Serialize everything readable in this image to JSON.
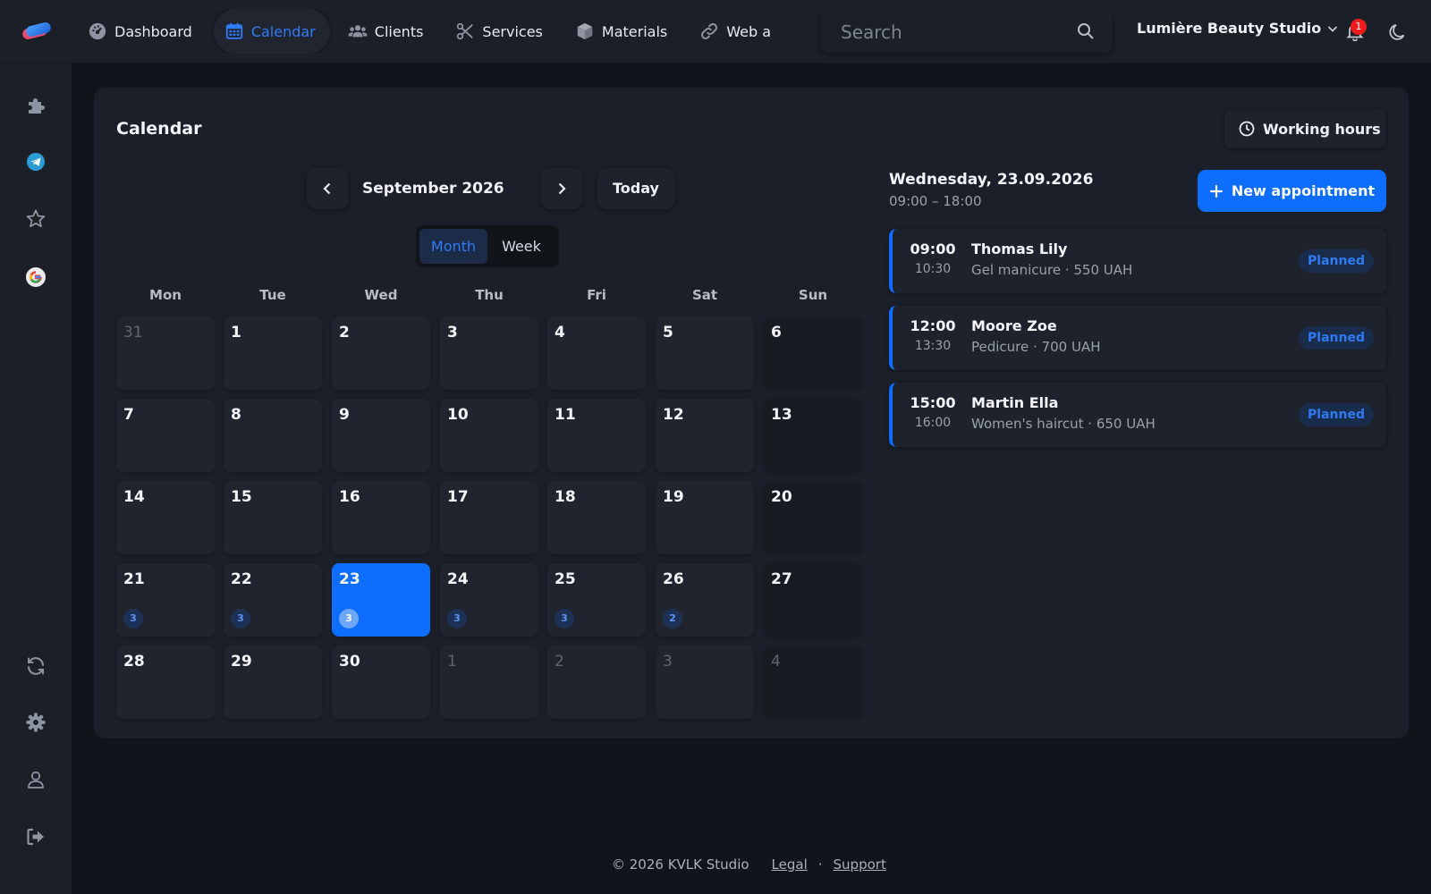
{
  "header": {
    "nav": [
      {
        "label": "Dashboard",
        "icon": "dashboard-icon",
        "active": false
      },
      {
        "label": "Calendar",
        "icon": "calendar-icon",
        "active": true
      },
      {
        "label": "Clients",
        "icon": "users-icon",
        "active": false
      },
      {
        "label": "Services",
        "icon": "scissors-icon",
        "active": false
      },
      {
        "label": "Materials",
        "icon": "box-icon",
        "active": false
      },
      {
        "label": "Web a",
        "icon": "link-icon",
        "active": false
      }
    ],
    "search_placeholder": "Search",
    "studio_name": "Lumière Beauty Studio",
    "notification_count": "1"
  },
  "sidebar": {
    "icons": [
      "puzzle-icon",
      "telegram-icon",
      "star-icon",
      "google-icon",
      "sync-icon",
      "gear-icon",
      "user-icon",
      "logout-icon"
    ]
  },
  "calendar": {
    "title": "Calendar",
    "working_hours_label": "Working hours",
    "month_label": "September 2026",
    "today_label": "Today",
    "views": [
      "Month",
      "Week"
    ],
    "active_view": "Month",
    "weekdays": [
      "Mon",
      "Tue",
      "Wed",
      "Thu",
      "Fri",
      "Sat",
      "Sun"
    ],
    "weeks": [
      [
        {
          "d": "31",
          "m": true
        },
        {
          "d": "1"
        },
        {
          "d": "2"
        },
        {
          "d": "3"
        },
        {
          "d": "4"
        },
        {
          "d": "5"
        },
        {
          "d": "6"
        }
      ],
      [
        {
          "d": "7"
        },
        {
          "d": "8"
        },
        {
          "d": "9"
        },
        {
          "d": "10"
        },
        {
          "d": "11"
        },
        {
          "d": "12"
        },
        {
          "d": "13"
        }
      ],
      [
        {
          "d": "14"
        },
        {
          "d": "15"
        },
        {
          "d": "16"
        },
        {
          "d": "17"
        },
        {
          "d": "18"
        },
        {
          "d": "19"
        },
        {
          "d": "20"
        }
      ],
      [
        {
          "d": "21",
          "c": "3"
        },
        {
          "d": "22",
          "c": "3"
        },
        {
          "d": "23",
          "c": "3",
          "sel": true
        },
        {
          "d": "24",
          "c": "3"
        },
        {
          "d": "25",
          "c": "3"
        },
        {
          "d": "26",
          "c": "2"
        },
        {
          "d": "27"
        }
      ],
      [
        {
          "d": "28"
        },
        {
          "d": "29"
        },
        {
          "d": "30"
        },
        {
          "d": "1",
          "m": true
        },
        {
          "d": "2",
          "m": true
        },
        {
          "d": "3",
          "m": true
        },
        {
          "d": "4",
          "m": true
        }
      ]
    ]
  },
  "day_panel": {
    "date_label": "Wednesday, 23.09.2026",
    "hours_label": "09:00 – 18:00",
    "new_appointment_label": "New appointment",
    "appointments": [
      {
        "start": "09:00",
        "end": "10:30",
        "client": "Thomas Lily",
        "details": "Gel manicure · 550 UAH",
        "status": "Planned"
      },
      {
        "start": "12:00",
        "end": "13:30",
        "client": "Moore Zoe",
        "details": "Pedicure · 700 UAH",
        "status": "Planned"
      },
      {
        "start": "15:00",
        "end": "16:00",
        "client": "Martin Ella",
        "details": "Women's haircut · 650 UAH",
        "status": "Planned"
      }
    ]
  },
  "footer": {
    "copyright": "© 2026 KVLK Studio",
    "legal": "Legal",
    "separator": "·",
    "support": "Support"
  },
  "colors": {
    "accent": "#0d6efd",
    "accent_text": "#2f7bf5",
    "background": "#11141b",
    "surface": "#1b1f28",
    "notification": "#ee1c1c"
  }
}
